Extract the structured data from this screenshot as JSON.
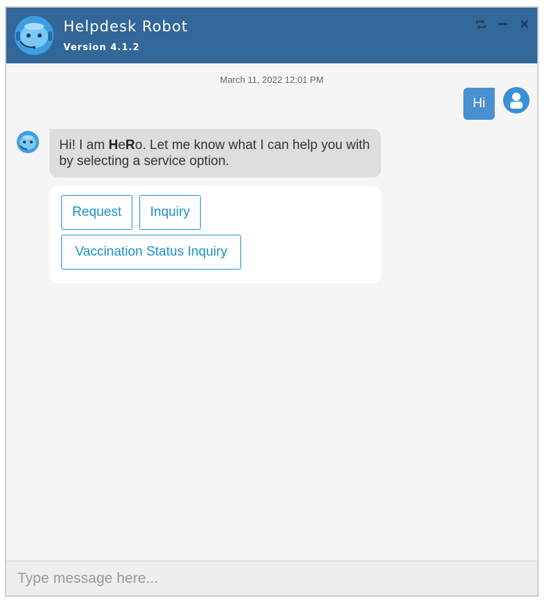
{
  "header": {
    "title": "Helpdesk Robot",
    "version": "Version 4.1.2",
    "controls": {
      "refresh_icon": "refresh-icon",
      "minimize_icon": "minimize-icon",
      "close_icon": "close-icon"
    },
    "color": "#336699"
  },
  "conversation": {
    "timestamp": "March 11, 2022 12:01 PM",
    "user_message": "Hi",
    "bot_message": {
      "part1": "Hi! I am ",
      "bold1": "H",
      "part2": "e",
      "bold2": "R",
      "part3": "o. Let me know what I can help you with by selecting a service option."
    },
    "options": [
      "Request",
      "Inquiry",
      "Vaccination Status Inquiry"
    ]
  },
  "input": {
    "placeholder": "Type message here..."
  },
  "colors": {
    "accent": "#1a8fc9",
    "user_bubble": "#4a8fcf",
    "bot_bubble": "#dddddd"
  }
}
